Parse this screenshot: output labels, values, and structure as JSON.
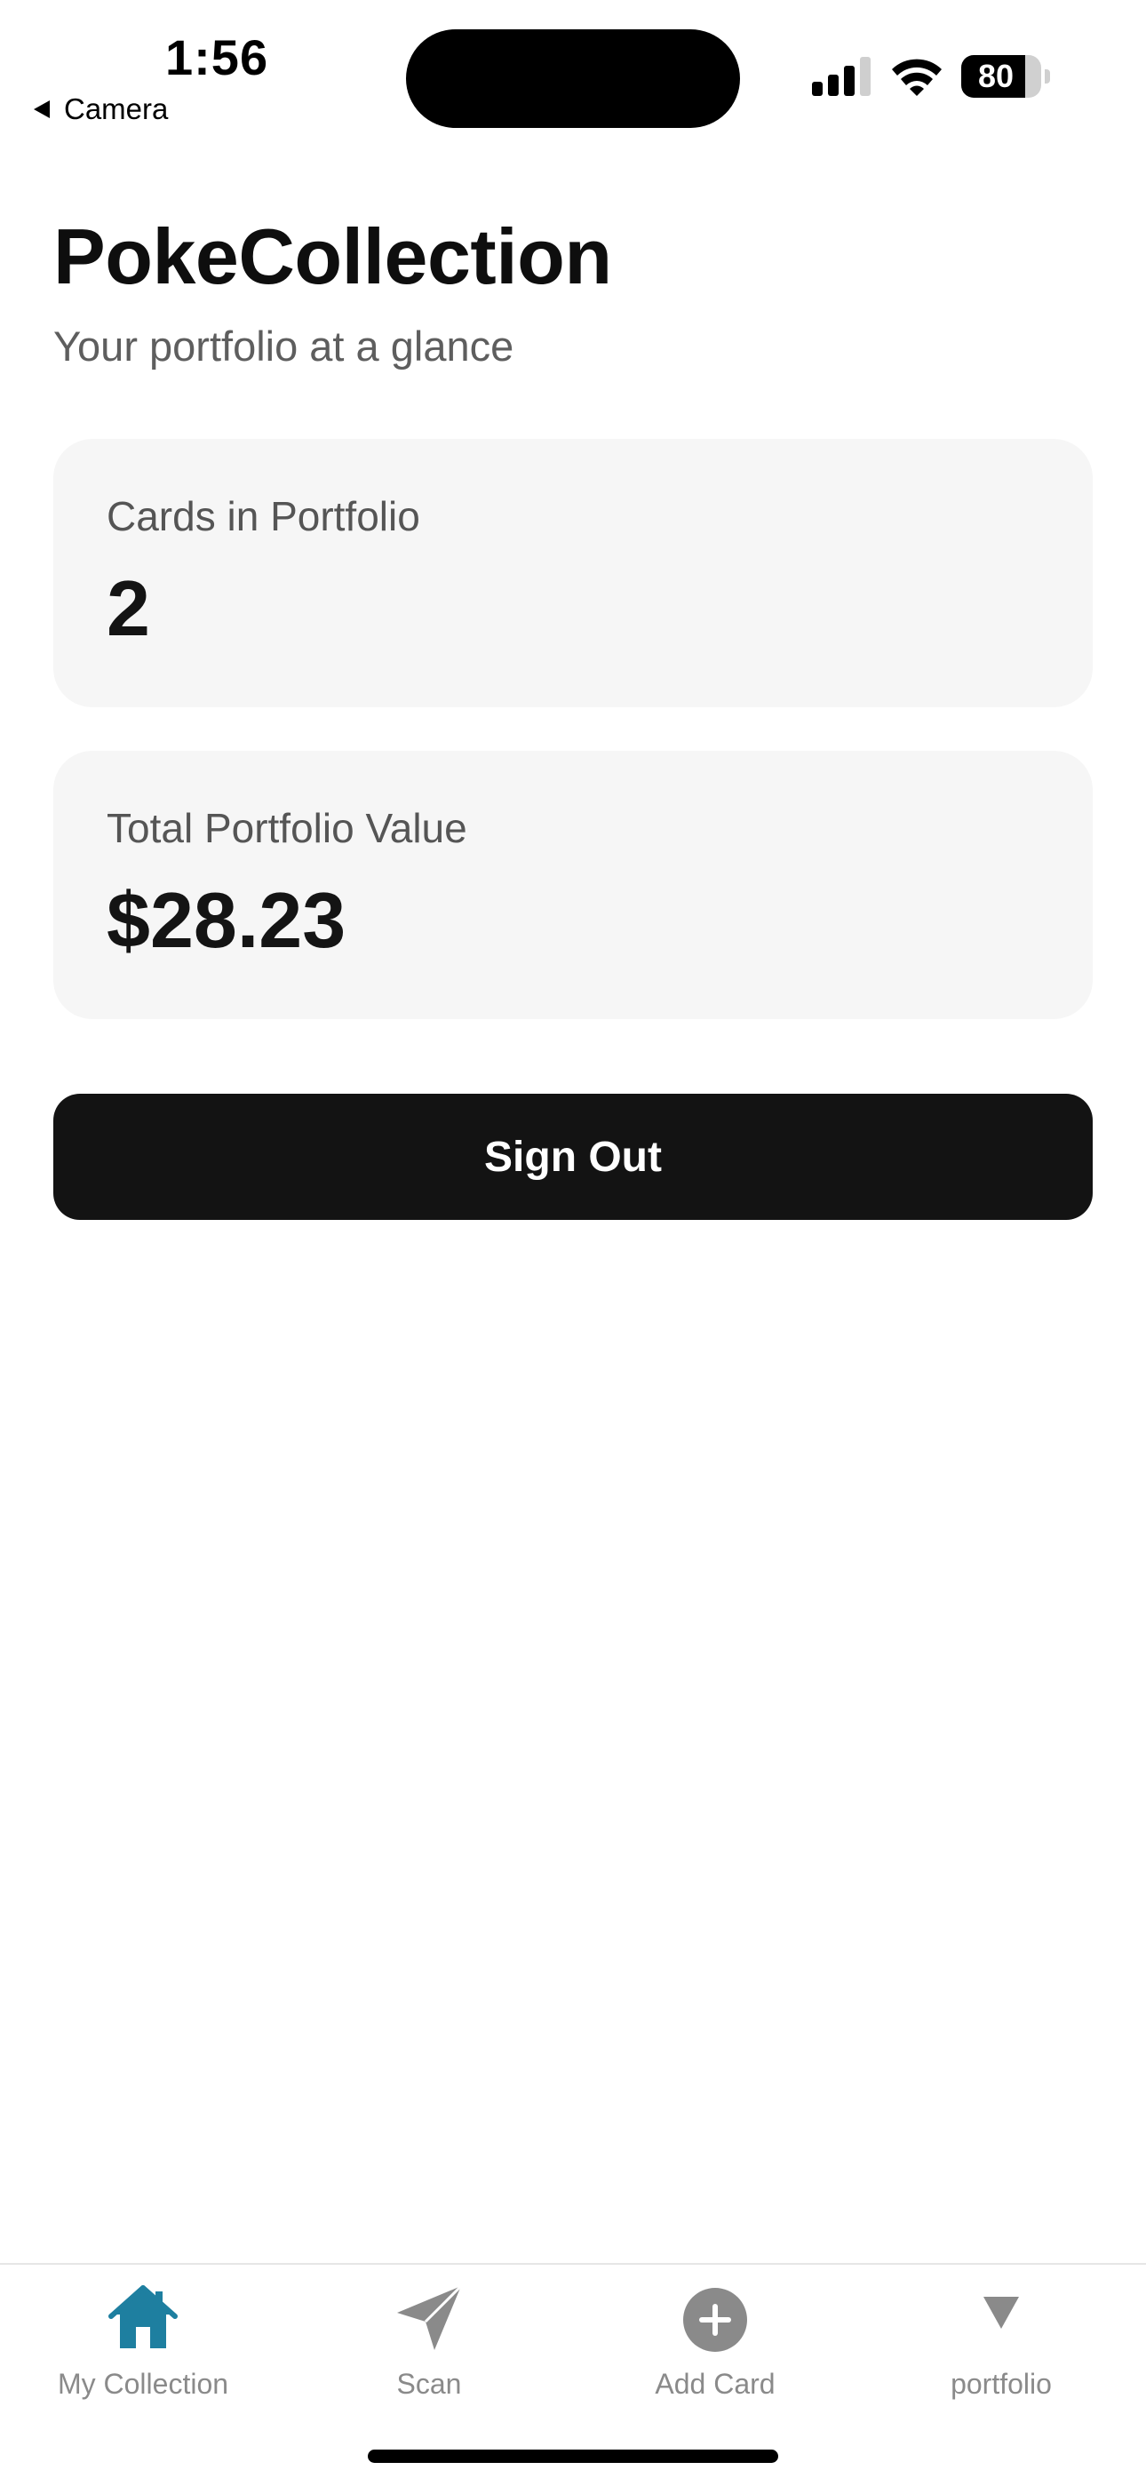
{
  "status_bar": {
    "time": "1:56",
    "back_label": "Camera",
    "battery_level": 80,
    "battery_text": "80"
  },
  "header": {
    "title": "PokeCollection",
    "subtitle": "Your portfolio at a glance"
  },
  "stats": {
    "cards": {
      "label": "Cards in Portfolio",
      "value": "2"
    },
    "value": {
      "label": "Total Portfolio Value",
      "value": "$28.23"
    }
  },
  "actions": {
    "sign_out_label": "Sign Out"
  },
  "tab_bar": {
    "active_color": "#1e7fa0",
    "inactive_color": "#8a8a8a",
    "tabs": [
      {
        "label": "My Collection",
        "icon": "home-icon",
        "active": true
      },
      {
        "label": "Scan",
        "icon": "paper-plane-icon",
        "active": false
      },
      {
        "label": "Add Card",
        "icon": "plus-circle-icon",
        "active": false
      },
      {
        "label": "portfolio",
        "icon": "triangle-down-icon",
        "active": false
      }
    ]
  }
}
